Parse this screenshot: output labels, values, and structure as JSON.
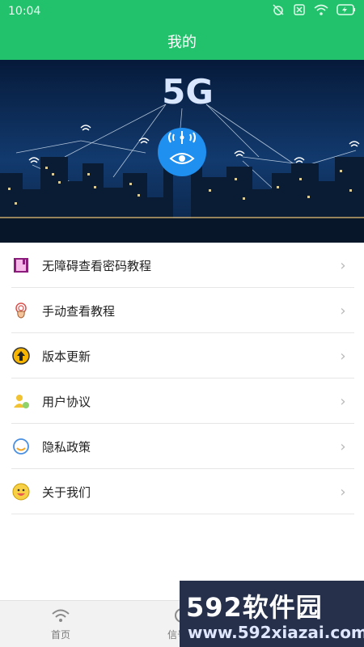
{
  "status_bar": {
    "time": "10:04",
    "icons": [
      "alarm-off-icon",
      "close-box-icon",
      "wifi-icon",
      "battery-charging-icon"
    ]
  },
  "header": {
    "title": "我的"
  },
  "banner": {
    "label": "5G"
  },
  "menu": {
    "items": [
      {
        "label": "无障碍查看密码教程",
        "icon": "book-icon"
      },
      {
        "label": "手动查看教程",
        "icon": "hand-icon"
      },
      {
        "label": "版本更新",
        "icon": "update-icon"
      },
      {
        "label": "用户协议",
        "icon": "user-icon"
      },
      {
        "label": "隐私政策",
        "icon": "privacy-icon"
      },
      {
        "label": "关于我们",
        "icon": "smile-icon"
      }
    ]
  },
  "bottom_nav": {
    "tabs": [
      {
        "label": "首页",
        "icon": "wifi-icon"
      },
      {
        "label": "信号增",
        "icon": "signal-icon"
      },
      {
        "label": "",
        "icon": ""
      }
    ]
  },
  "watermark": {
    "top_text": "592软件园",
    "url": "www.592xiazai.com"
  },
  "colors": {
    "primary": "#21c26b",
    "watermark_bg": "#26304a",
    "watermark_accent": "#4d8bff"
  }
}
